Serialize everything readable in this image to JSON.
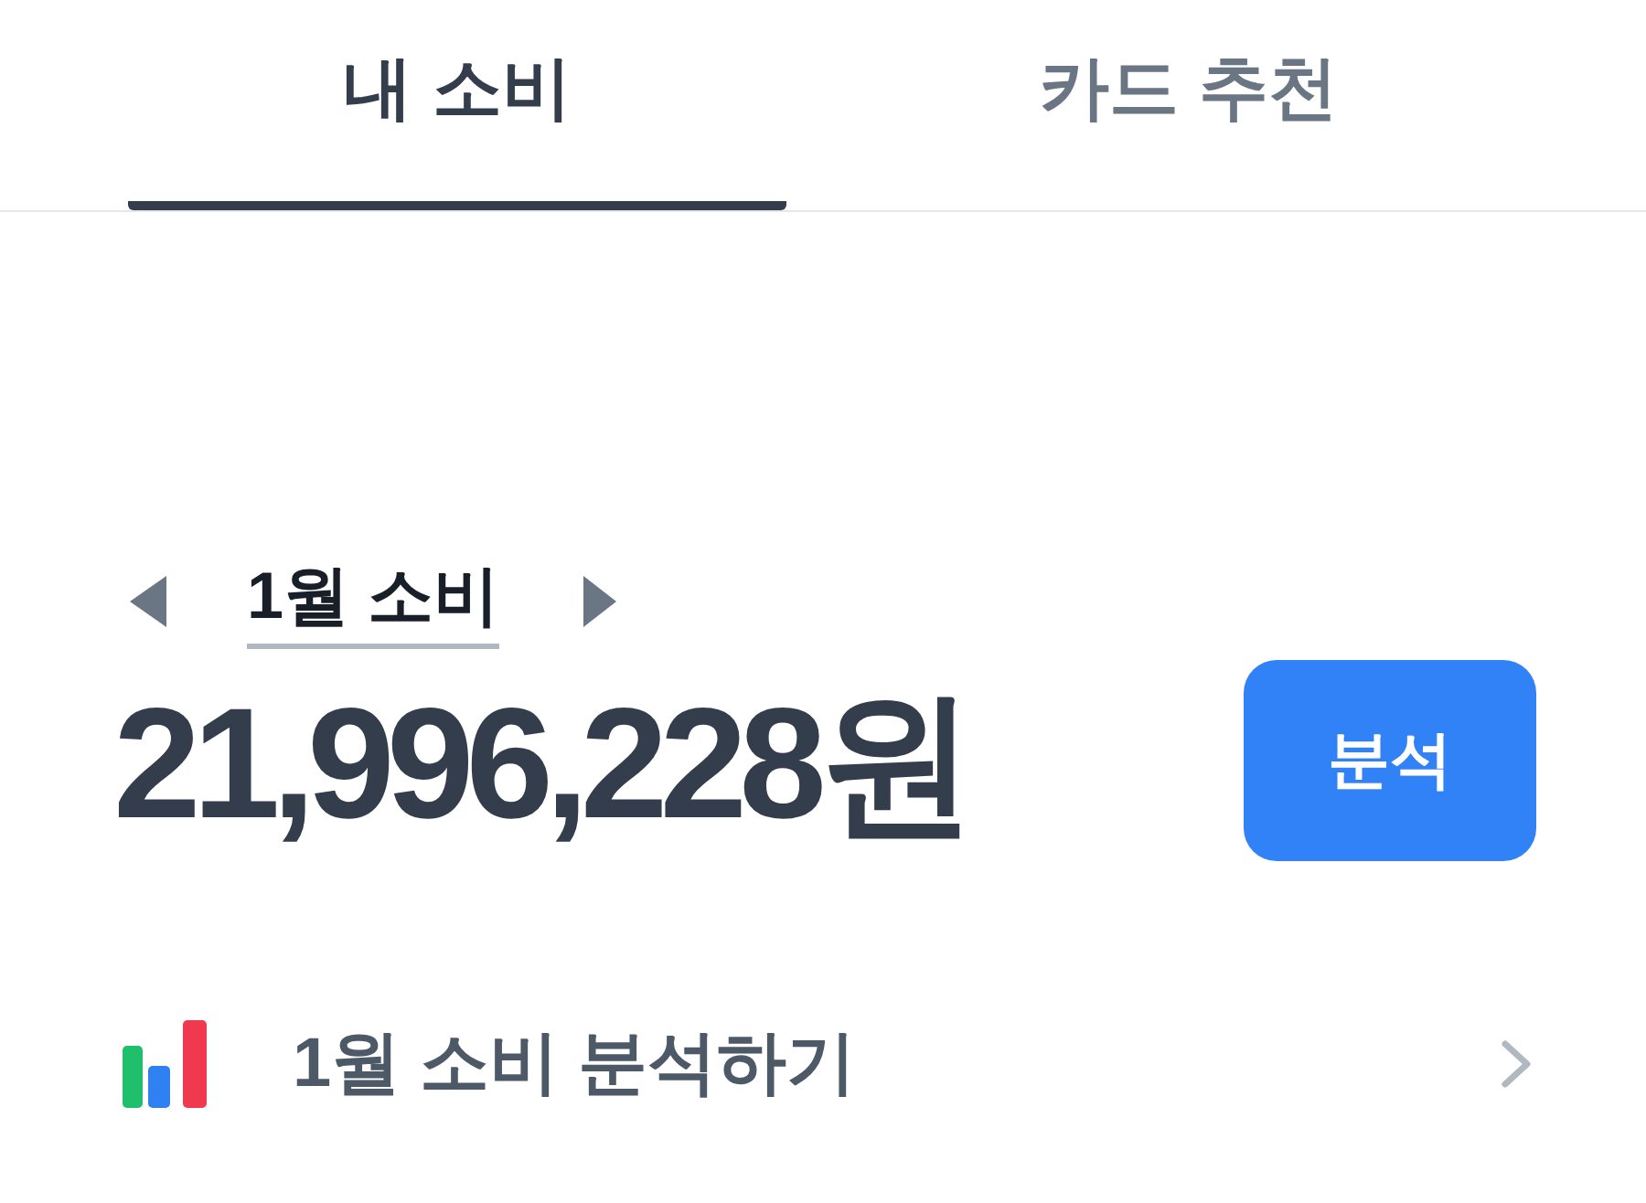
{
  "tabs": [
    {
      "label": "내 소비",
      "selected": true
    },
    {
      "label": "카드 추천",
      "selected": false
    }
  ],
  "month_selector": {
    "label": "1월 소비"
  },
  "total": {
    "amount": "21,996,228원"
  },
  "analyze_button": {
    "label": "분석"
  },
  "menu_row": {
    "label": "1월 소비 분석하기"
  }
}
